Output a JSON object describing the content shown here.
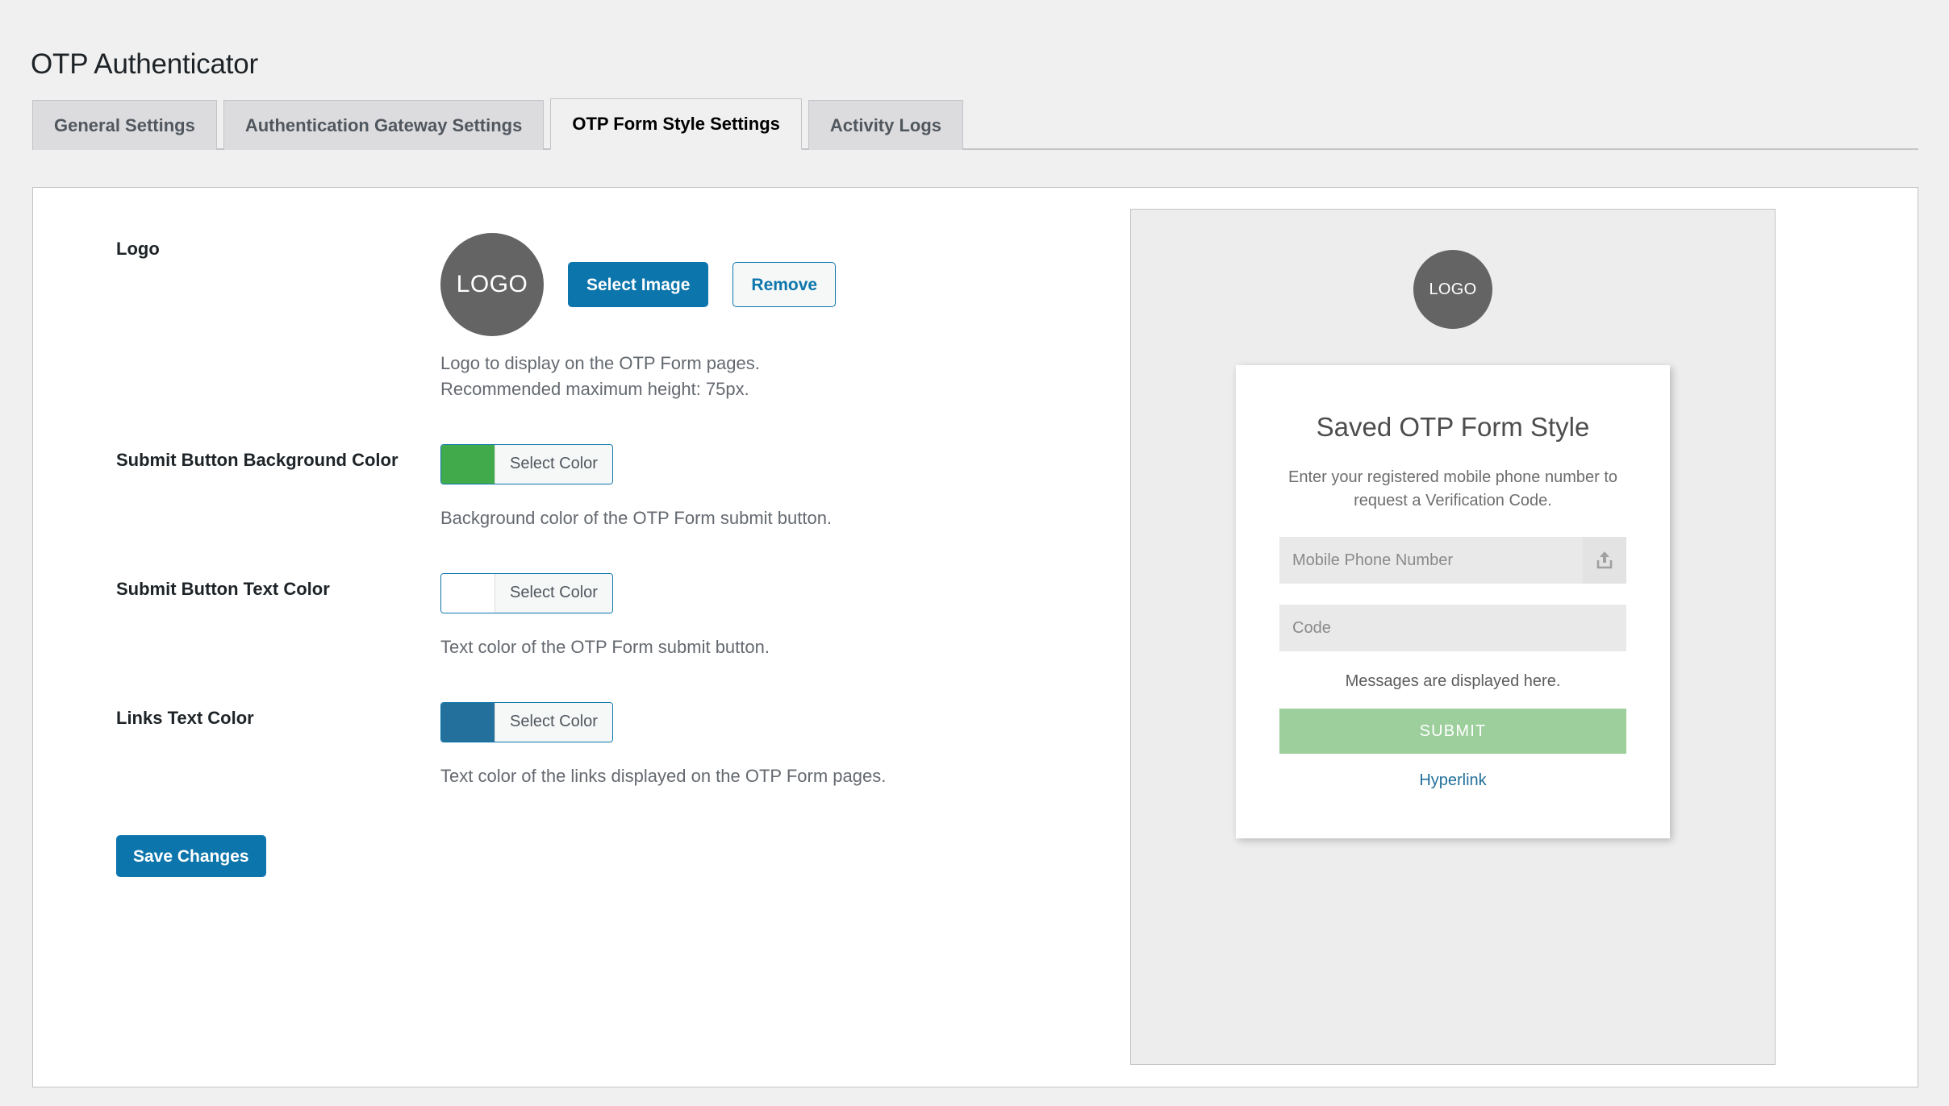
{
  "page": {
    "title": "OTP Authenticator"
  },
  "tabs": [
    {
      "label": "General Settings",
      "active": false
    },
    {
      "label": "Authentication Gateway Settings",
      "active": false
    },
    {
      "label": "OTP Form Style Settings",
      "active": true
    },
    {
      "label": "Activity Logs",
      "active": false
    }
  ],
  "settings": {
    "logo": {
      "label": "Logo",
      "placeholder_text": "LOGO",
      "select_image_label": "Select Image",
      "remove_label": "Remove",
      "description_line1": "Logo to display on the OTP Form pages.",
      "description_line2": "Recommended maximum height: 75px."
    },
    "submit_bg": {
      "label": "Submit Button Background Color",
      "select_color_label": "Select Color",
      "color": "#41ab4c",
      "description": "Background color of the OTP Form submit button."
    },
    "submit_text": {
      "label": "Submit Button Text Color",
      "select_color_label": "Select Color",
      "color": "#ffffff",
      "description": "Text color of the OTP Form submit button."
    },
    "links_text": {
      "label": "Links Text Color",
      "select_color_label": "Select Color",
      "color": "#22709b",
      "description": "Text color of the links displayed on the OTP Form pages."
    },
    "save_label": "Save Changes"
  },
  "preview": {
    "logo_text": "LOGO",
    "title": "Saved OTP Form Style",
    "subtitle": "Enter your registered mobile phone number to request a Verification Code.",
    "phone_placeholder": "Mobile Phone Number",
    "code_placeholder": "Code",
    "message_text": "Messages are displayed here.",
    "submit_label": "SUBMIT",
    "link_label": "Hyperlink",
    "submit_bg_color": "#9ccf9c",
    "submit_text_color": "#ffffff",
    "link_color": "#22709b"
  }
}
